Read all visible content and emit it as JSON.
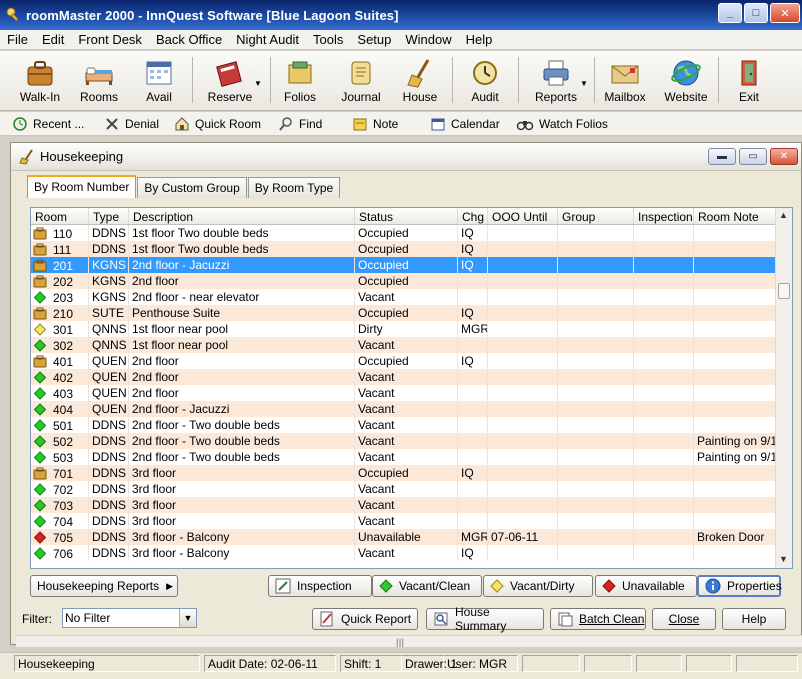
{
  "window": {
    "title": "roomMaster 2000 - InnQuest Software [Blue Lagoon Suites]"
  },
  "menu": [
    "File",
    "Edit",
    "Front Desk",
    "Back Office",
    "Night Audit",
    "Tools",
    "Setup",
    "Window",
    "Help"
  ],
  "toolbar": {
    "walkin": "Walk-In",
    "rooms": "Rooms",
    "avail": "Avail",
    "reserve": "Reserve",
    "folios": "Folios",
    "journal": "Journal",
    "house": "House",
    "audit": "Audit",
    "reports": "Reports",
    "mailbox": "Mailbox",
    "website": "Website",
    "exit": "Exit"
  },
  "toolbar2": {
    "recent": "Recent ...",
    "denial": "Denial",
    "quick_room": "Quick Room",
    "find": "Find",
    "note": "Note",
    "calendar": "Calendar",
    "watch_folios": "Watch Folios"
  },
  "housekeeping": {
    "title": "Housekeeping",
    "tabs": [
      "By Room Number",
      "By Custom Group",
      "By Room Type"
    ],
    "columns": [
      "Room",
      "Type",
      "Description",
      "Status",
      "Chg",
      "OOO Until",
      "Group",
      "Inspection",
      "Room Note"
    ],
    "rows": [
      {
        "room": "110",
        "type": "DDNS",
        "desc": "1st floor Two double beds",
        "status": "Occupied",
        "chg": "IQ",
        "ooo": "",
        "note": "",
        "icon": "folder"
      },
      {
        "room": "111",
        "type": "DDNS",
        "desc": "1st floor Two double beds",
        "status": "Occupied",
        "chg": "IQ",
        "ooo": "",
        "note": "",
        "icon": "folder"
      },
      {
        "room": "201",
        "type": "KGNS",
        "desc": "2nd floor - Jacuzzi",
        "status": "Occupied",
        "chg": "IQ",
        "ooo": "",
        "note": "",
        "icon": "folder"
      },
      {
        "room": "202",
        "type": "KGNS",
        "desc": "2nd floor",
        "status": "Occupied",
        "chg": "",
        "ooo": "",
        "note": "",
        "icon": "folder"
      },
      {
        "room": "203",
        "type": "KGNS",
        "desc": "2nd floor - near elevator",
        "status": "Vacant",
        "chg": "",
        "ooo": "",
        "note": "",
        "icon": "green"
      },
      {
        "room": "210",
        "type": "SUTE",
        "desc": "Penthouse Suite",
        "status": "Occupied",
        "chg": "IQ",
        "ooo": "",
        "note": "",
        "icon": "folder"
      },
      {
        "room": "301",
        "type": "QNNS",
        "desc": "1st floor near pool",
        "status": "Dirty",
        "chg": "MGR",
        "ooo": "",
        "note": "",
        "icon": "yellow"
      },
      {
        "room": "302",
        "type": "QNNS",
        "desc": "1st floor near pool",
        "status": "Vacant",
        "chg": "",
        "ooo": "",
        "note": "",
        "icon": "green"
      },
      {
        "room": "401",
        "type": "QUEN",
        "desc": "2nd floor",
        "status": "Occupied",
        "chg": "IQ",
        "ooo": "",
        "note": "",
        "icon": "folder"
      },
      {
        "room": "402",
        "type": "QUEN",
        "desc": "2nd floor",
        "status": "Vacant",
        "chg": "",
        "ooo": "",
        "note": "",
        "icon": "green"
      },
      {
        "room": "403",
        "type": "QUEN",
        "desc": "2nd floor",
        "status": "Vacant",
        "chg": "",
        "ooo": "",
        "note": "",
        "icon": "green"
      },
      {
        "room": "404",
        "type": "QUEN",
        "desc": "2nd floor - Jacuzzi",
        "status": "Vacant",
        "chg": "",
        "ooo": "",
        "note": "",
        "icon": "green"
      },
      {
        "room": "501",
        "type": "DDNS",
        "desc": "2nd floor - Two double beds",
        "status": "Vacant",
        "chg": "",
        "ooo": "",
        "note": "",
        "icon": "green"
      },
      {
        "room": "502",
        "type": "DDNS",
        "desc": "2nd floor - Two double beds",
        "status": "Vacant",
        "chg": "",
        "ooo": "",
        "note": "Painting on 9/1",
        "icon": "green"
      },
      {
        "room": "503",
        "type": "DDNS",
        "desc": "2nd floor - Two double beds",
        "status": "Vacant",
        "chg": "",
        "ooo": "",
        "note": "Painting on 9/1",
        "icon": "green"
      },
      {
        "room": "701",
        "type": "DDNS",
        "desc": "3rd floor",
        "status": "Occupied",
        "chg": "IQ",
        "ooo": "",
        "note": "",
        "icon": "folder"
      },
      {
        "room": "702",
        "type": "DDNS",
        "desc": "3rd floor",
        "status": "Vacant",
        "chg": "",
        "ooo": "",
        "note": "",
        "icon": "green"
      },
      {
        "room": "703",
        "type": "DDNS",
        "desc": "3rd floor",
        "status": "Vacant",
        "chg": "",
        "ooo": "",
        "note": "",
        "icon": "green"
      },
      {
        "room": "704",
        "type": "DDNS",
        "desc": "3rd floor",
        "status": "Vacant",
        "chg": "",
        "ooo": "",
        "note": "",
        "icon": "green"
      },
      {
        "room": "705",
        "type": "DDNS",
        "desc": "3rd floor - Balcony",
        "status": "Unavailable",
        "chg": "MGR",
        "ooo": "07-06-11",
        "note": "Broken Door",
        "icon": "red"
      },
      {
        "room": "706",
        "type": "DDNS",
        "desc": "3rd floor - Balcony",
        "status": "Vacant",
        "chg": "IQ",
        "ooo": "",
        "note": "",
        "icon": "green"
      }
    ],
    "selected_room": "201",
    "buttons": {
      "reports": "Housekeeping Reports",
      "inspection": "Inspection",
      "vacant_clean": "Vacant/Clean",
      "vacant_dirty": "Vacant/Dirty",
      "unavailable": "Unavailable",
      "properties": "Properties"
    }
  },
  "bottom": {
    "filter_label": "Filter:",
    "filter_value": "No Filter",
    "quick_report": "Quick Report",
    "house_summary": "House Summary",
    "batch_clean": "Batch Clean",
    "close": "Close",
    "help": "Help"
  },
  "status": {
    "module": "Housekeeping",
    "audit_date": "Audit Date: 02-06-11",
    "shift": "Shift: 1",
    "drawer": "Drawer: 1",
    "user": "User: MGR"
  }
}
